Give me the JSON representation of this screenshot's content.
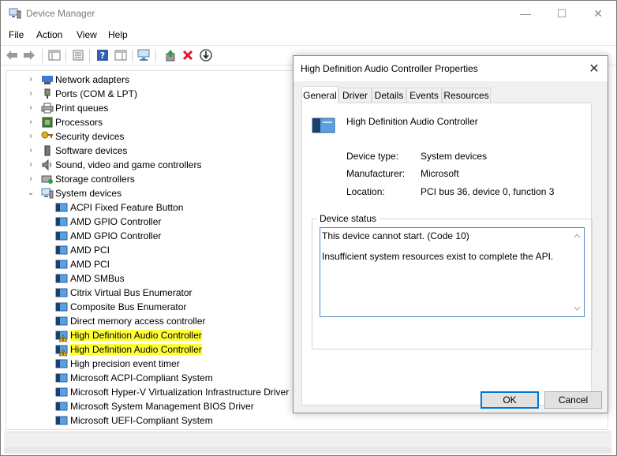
{
  "window": {
    "title": "Device Manager",
    "minimize": "—",
    "maximize": "☐",
    "close": "✕"
  },
  "menu": [
    "File",
    "Action",
    "View",
    "Help"
  ],
  "tree": {
    "categories": [
      {
        "label": "Network adapters",
        "expanded": false
      },
      {
        "label": "Ports (COM & LPT)",
        "expanded": false
      },
      {
        "label": "Print queues",
        "expanded": false
      },
      {
        "label": "Processors",
        "expanded": false
      },
      {
        "label": "Security devices",
        "expanded": false
      },
      {
        "label": "Software devices",
        "expanded": false
      },
      {
        "label": "Sound, video and game controllers",
        "expanded": false
      },
      {
        "label": "Storage controllers",
        "expanded": false
      },
      {
        "label": "System devices",
        "expanded": true
      }
    ],
    "system_devices": [
      {
        "label": "ACPI Fixed Feature Button",
        "warning": false
      },
      {
        "label": "AMD GPIO Controller",
        "warning": false
      },
      {
        "label": "AMD GPIO Controller",
        "warning": false
      },
      {
        "label": "AMD PCI",
        "warning": false
      },
      {
        "label": "AMD PCI",
        "warning": false
      },
      {
        "label": "AMD SMBus",
        "warning": false
      },
      {
        "label": "Citrix Virtual Bus Enumerator",
        "warning": false
      },
      {
        "label": "Composite Bus Enumerator",
        "warning": false
      },
      {
        "label": "Direct memory access controller",
        "warning": false
      },
      {
        "label": "High Definition Audio Controller",
        "warning": true
      },
      {
        "label": "High Definition Audio Controller",
        "warning": true
      },
      {
        "label": "High precision event timer",
        "warning": false
      },
      {
        "label": "Microsoft ACPI-Compliant System",
        "warning": false
      },
      {
        "label": "Microsoft Hyper-V Virtualization Infrastructure Driver",
        "warning": false
      },
      {
        "label": "Microsoft System Management BIOS Driver",
        "warning": false
      },
      {
        "label": "Microsoft UEFI-Compliant System",
        "warning": false
      }
    ]
  },
  "dialog": {
    "title": "High Definition Audio Controller Properties",
    "close": "✕",
    "tabs": [
      "General",
      "Driver",
      "Details",
      "Events",
      "Resources"
    ],
    "device_name": "High Definition Audio Controller",
    "device_type_label": "Device type:",
    "device_type_value": "System devices",
    "manufacturer_label": "Manufacturer:",
    "manufacturer_value": "Microsoft",
    "location_label": "Location:",
    "location_value": "PCI bus 36, device 0, function 3",
    "status_group_label": "Device status",
    "status_line1": "This device cannot start. (Code 10)",
    "status_line2": "Insufficient system resources exist to complete the API.",
    "ok_label": "OK",
    "cancel_label": "Cancel"
  },
  "colors": {
    "highlight": "#ffff37",
    "focus_border": "#0078d7",
    "warning": "#f5b400",
    "remove_red": "#e81123"
  }
}
